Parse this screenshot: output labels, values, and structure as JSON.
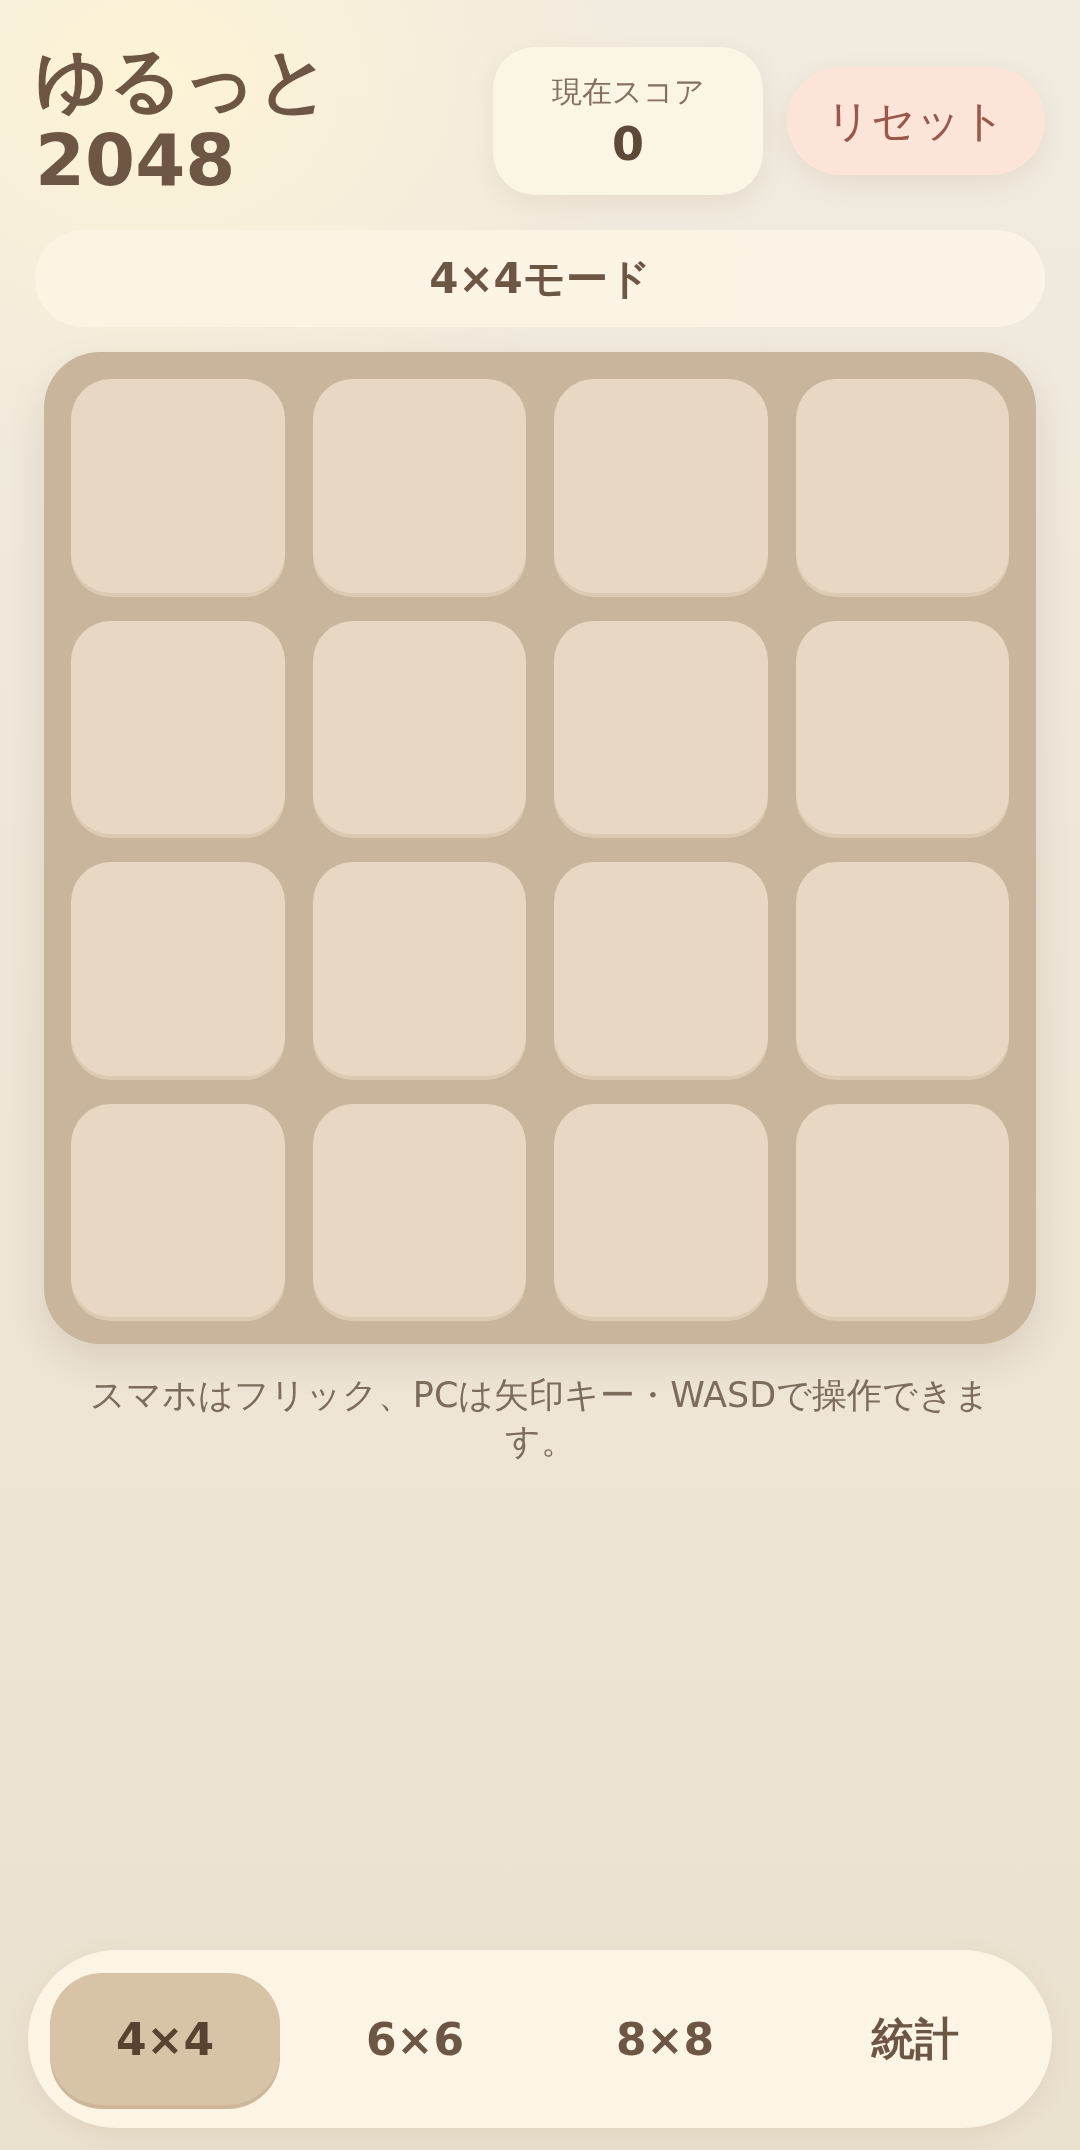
{
  "header": {
    "title": "ゆるっと 2048",
    "score": {
      "label": "現在スコア",
      "value": "0"
    },
    "reset_button": "リセット"
  },
  "mode_label": "4×4モード",
  "board": {
    "tiles": [
      {
        "kind": "empty"
      },
      {
        "kind": "empty"
      },
      {
        "kind": "empty"
      },
      {
        "kind": "empty"
      },
      {
        "kind": "empty"
      },
      {
        "kind": "empty"
      },
      {
        "kind": "empty"
      },
      {
        "kind": "empty"
      },
      {
        "kind": "empty"
      },
      {
        "kind": "empty"
      },
      {
        "kind": "empty"
      },
      {
        "kind": "empty"
      },
      {
        "kind": "empty"
      },
      {
        "kind": "empty"
      },
      {
        "kind": "empty"
      },
      {
        "kind": "empty"
      }
    ]
  },
  "hint": "スマホはフリック、PCは矢印キー・WASDで操作できます。",
  "tabs": [
    {
      "label": "4×4",
      "selected": true
    },
    {
      "label": "6×6",
      "selected": false
    },
    {
      "label": "8×8",
      "selected": false
    },
    {
      "label": "統計",
      "selected": false
    }
  ]
}
